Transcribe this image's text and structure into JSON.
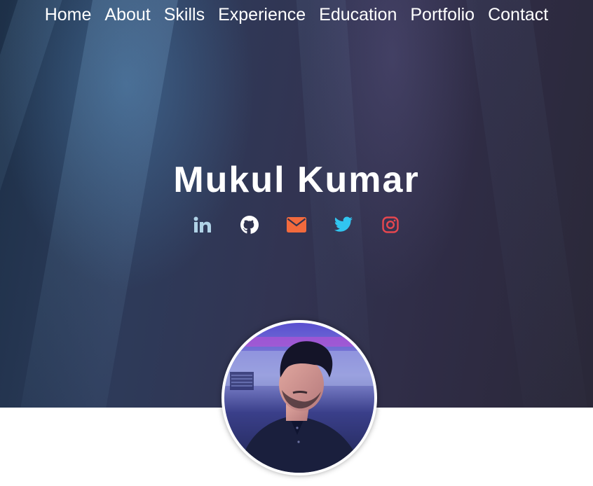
{
  "nav": {
    "items": [
      {
        "label": "Home"
      },
      {
        "label": "About"
      },
      {
        "label": "Skills"
      },
      {
        "label": "Experience"
      },
      {
        "label": "Education"
      },
      {
        "label": "Portfolio"
      },
      {
        "label": "Contact"
      }
    ]
  },
  "hero": {
    "name": "Mukul Kumar"
  },
  "socials": [
    {
      "icon": "linkedin-icon",
      "color": "#b0d2e6"
    },
    {
      "icon": "github-icon",
      "color": "#ffffff"
    },
    {
      "icon": "envelope-icon",
      "color": "#f26a3d"
    },
    {
      "icon": "twitter-icon",
      "color": "#31c5f0"
    },
    {
      "icon": "instagram-icon",
      "color": "#e6474f"
    }
  ]
}
